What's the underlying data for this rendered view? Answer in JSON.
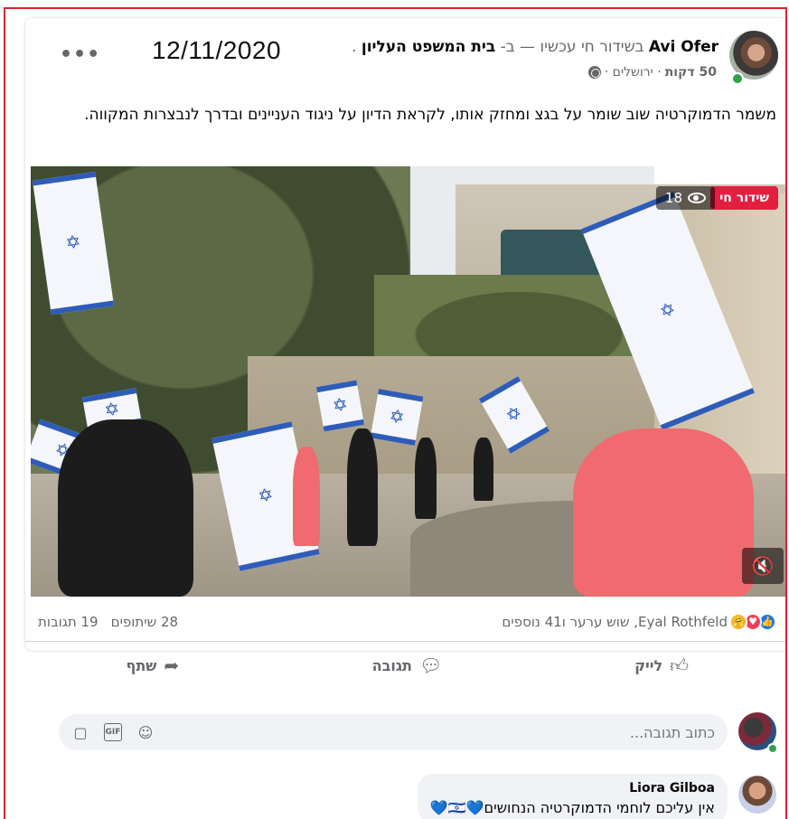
{
  "post": {
    "stamp_date": "12/11/2020",
    "author": "Avi Ofer",
    "live_text": "בשידור חי עכשיו — ב-",
    "place": "בית המשפט העליון",
    "place_suffix": ".",
    "time": "50 דקות",
    "location": "· ירושלים ·",
    "text": "משמר הדמוקרטיה שוב שומר על בגצ ומחזק אותו, לקראת הדיון על ניגוד העניינים ובדרך לנבצרות המקווה.",
    "more_icon": "more-dots-icon"
  },
  "video": {
    "live_badge": "שידור חי",
    "viewers": "18",
    "eye_icon": "eye-icon",
    "mute_icon": "mute-icon"
  },
  "stats": {
    "reactions_text": "Eyal Rothfeld, שוש ערער ו41 נוספים",
    "comments": "19 תגובות",
    "shares": "28 שיתופים",
    "reaction_icons": [
      "like-reaction-icon",
      "love-reaction-icon",
      "care-reaction-icon"
    ]
  },
  "actions": {
    "like": "לייק",
    "comment": "תגובה",
    "share": "שתף"
  },
  "composer": {
    "placeholder": "כתוב תגובה..."
  },
  "comment": {
    "author": "Liora Gilboa",
    "text": "אין עליכם לוחמי הדמוקרטיה הנחושים💙🇮🇱💙"
  }
}
